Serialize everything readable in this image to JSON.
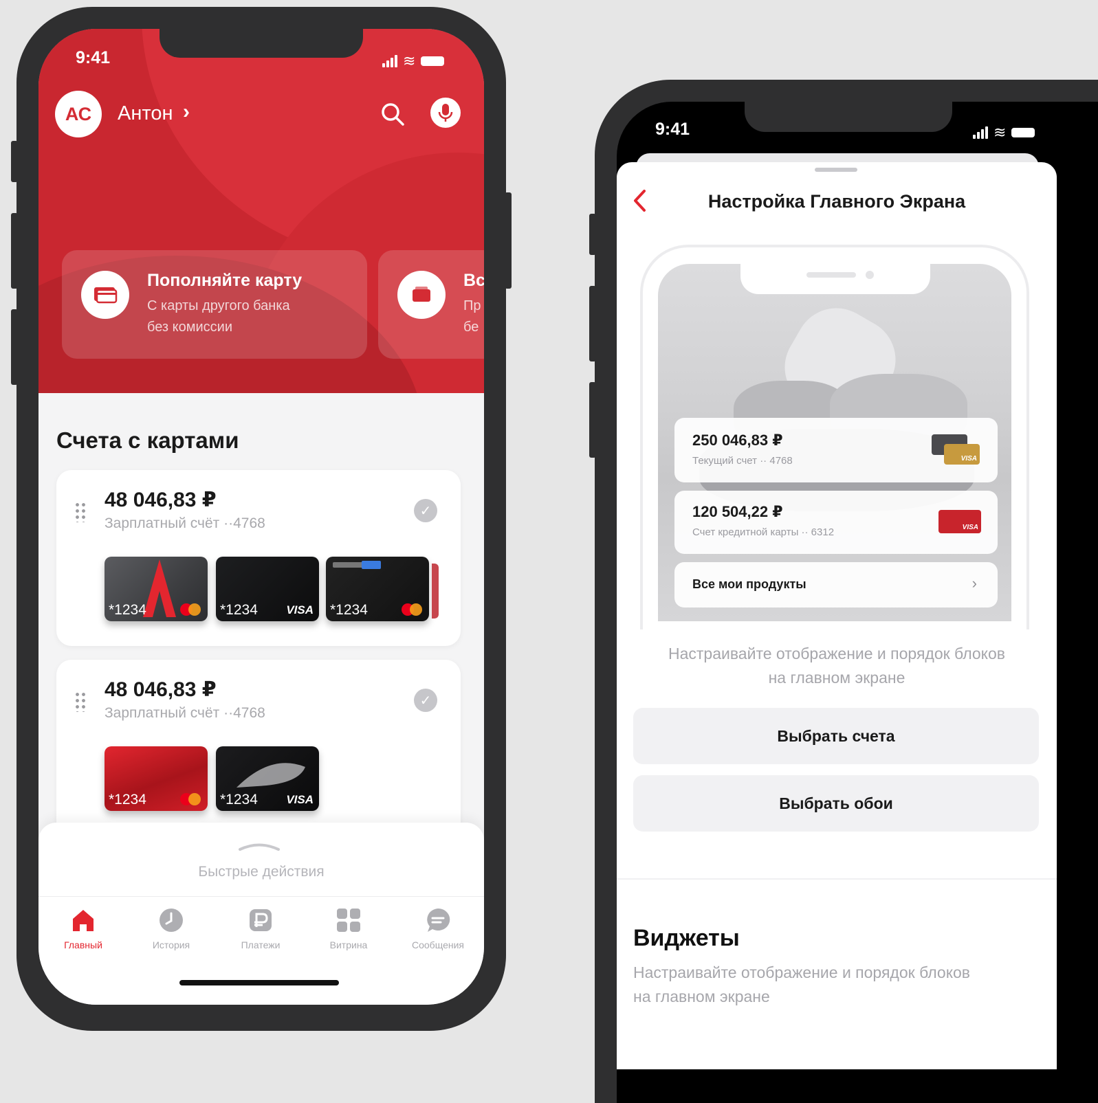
{
  "phone1": {
    "status": {
      "time": "9:41"
    },
    "header": {
      "avatar_initials": "АС",
      "user_name": "Антон",
      "user_chevron": "›"
    },
    "promos": [
      {
        "title": "Пополняйте карту",
        "subtitle_line1": "С карты другого банка",
        "subtitle_line2": "без комиссии",
        "icon": "card-icon"
      },
      {
        "title": "Вс",
        "subtitle_line1": "Пр",
        "subtitle_line2": "бе",
        "icon": "wallet-icon"
      }
    ],
    "accounts_title": "Счета с картами",
    "accounts": [
      {
        "amount": "48 046,83 ₽",
        "subtitle": "Зарплатный счёт ··4768",
        "cards": [
          {
            "number": "*1234",
            "brand": "mastercard"
          },
          {
            "number": "*1234",
            "brand": "VISA"
          },
          {
            "number": "*1234",
            "brand": "mastercard"
          }
        ]
      },
      {
        "amount": "48 046,83 ₽",
        "subtitle": "Зарплатный счёт ··4768",
        "cards": [
          {
            "number": "*1234",
            "brand": "mastercard"
          },
          {
            "number": "*1234",
            "brand": "VISA"
          }
        ]
      }
    ],
    "quick_actions": "Быстрые действия",
    "tabs": [
      {
        "label": "Главный",
        "icon": "home-icon",
        "active": true
      },
      {
        "label": "История",
        "icon": "clock-icon",
        "active": false
      },
      {
        "label": "Платежи",
        "icon": "payments-icon",
        "active": false
      },
      {
        "label": "Витрина",
        "icon": "grid-icon",
        "active": false
      },
      {
        "label": "Сообщения",
        "icon": "chat-icon",
        "active": false
      }
    ]
  },
  "phone2": {
    "status": {
      "time": "9:41"
    },
    "title": "Настройка Главного Экрана",
    "preview": {
      "rows": [
        {
          "amount": "250 046,83 ₽",
          "subtitle": "Текущий счет ·· 4768",
          "card_brand": "VISA"
        },
        {
          "amount": "120 504,22 ₽",
          "subtitle": "Счет кредитной карты ·· 6312",
          "card_brand": "VISA"
        }
      ],
      "all_products": "Все мои продукты"
    },
    "hint": "Настраивайте отображение и порядок блоков на главном экране",
    "buttons": {
      "choose_accounts": "Выбрать счета",
      "choose_wallpaper": "Выбрать обои"
    },
    "widgets_title": "Виджеты",
    "widgets_subtitle": "Настраивайте отображение и порядок блоков на главном экране"
  },
  "colors": {
    "brand_red": "#d42c34",
    "active_tab": "#e3262f",
    "background": "#e6e6e6",
    "phone_frame": "#2f2f30"
  }
}
